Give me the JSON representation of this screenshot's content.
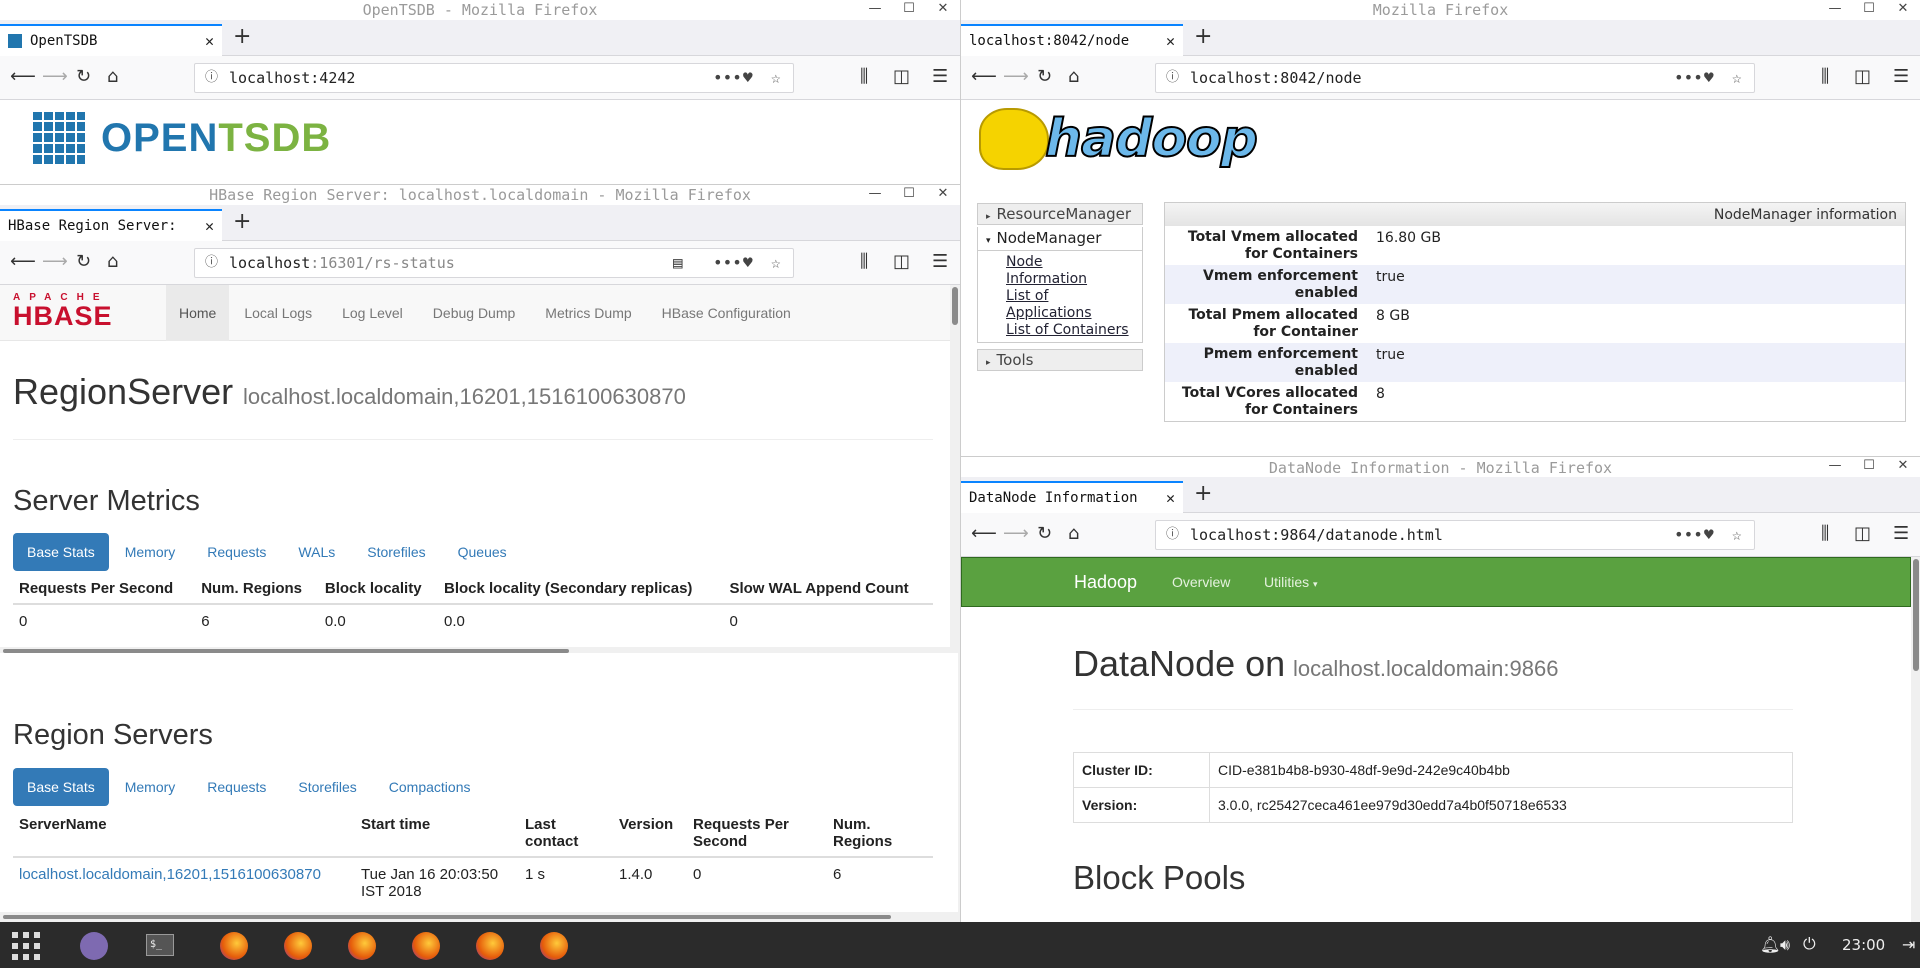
{
  "opentsdb_window": {
    "title": "OpenTSDB - Mozilla Firefox",
    "tab": "OpenTSDB",
    "url": "localhost:4242",
    "logo_open": "OPEN",
    "logo_tsdb": "TSDB"
  },
  "hbase_window": {
    "title": "HBase Region Server: localhost.localdomain - Mozilla Firefox",
    "tab": "HBase Region Server:",
    "url_host": "localhost",
    "url_rest": ":16301/rs-status",
    "nav": [
      "Home",
      "Local Logs",
      "Log Level",
      "Debug Dump",
      "Metrics Dump",
      "HBase Configuration"
    ],
    "logo_top": "APACHE",
    "logo_main": "HBASE",
    "heading": "RegionServer",
    "heading_sub": "localhost.localdomain,16201,1516100630870",
    "server_metrics": "Server Metrics",
    "metrics_tabs": [
      "Base Stats",
      "Memory",
      "Requests",
      "WALs",
      "Storefiles",
      "Queues"
    ],
    "metrics_headers": [
      "Requests Per Second",
      "Num. Regions",
      "Block locality",
      "Block locality (Secondary replicas)",
      "Slow WAL Append Count"
    ],
    "metrics_row": [
      "0",
      "6",
      "0.0",
      "0.0",
      "0"
    ],
    "region_servers": "Region Servers",
    "rs_tabs": [
      "Base Stats",
      "Memory",
      "Requests",
      "Storefiles",
      "Compactions"
    ],
    "rs_headers": [
      "ServerName",
      "Start time",
      "Last contact",
      "Version",
      "Requests Per Second",
      "Num. Regions"
    ],
    "rs_row": [
      "localhost.localdomain,16201,1516100630870",
      "Tue Jan 16 20:03:50 IST 2018",
      "1 s",
      "1.4.0",
      "0",
      "6"
    ]
  },
  "hadoop_window": {
    "title": "Mozilla Firefox",
    "tab": "localhost:8042/node",
    "url": "localhost:8042/node",
    "logo": "hadoop",
    "menu": {
      "resource_manager": "ResourceManager",
      "node_manager": "NodeManager",
      "links": [
        "Node Information",
        "List of Applications",
        "List of Containers"
      ],
      "tools": "Tools"
    },
    "info_title": "NodeManager information",
    "rows": [
      {
        "k": "Total Vmem allocated for Containers",
        "v": "16.80 GB"
      },
      {
        "k": "Vmem enforcement enabled",
        "v": "true"
      },
      {
        "k": "Total Pmem allocated for Container",
        "v": "8 GB"
      },
      {
        "k": "Pmem enforcement enabled",
        "v": "true"
      },
      {
        "k": "Total VCores allocated for Containers",
        "v": "8"
      }
    ]
  },
  "datanode_window": {
    "title": "DataNode Information - Mozilla Firefox",
    "tab": "DataNode Information",
    "url": "localhost:9864/datanode.html",
    "brand": "Hadoop",
    "nav": [
      "Overview",
      "Utilities"
    ],
    "heading": "DataNode on",
    "heading_sub": "localhost.localdomain:9866",
    "rows": [
      {
        "k": "Cluster ID:",
        "v": "CID-e381b4b8-b930-48df-9e9d-242e9c40b4bb"
      },
      {
        "k": "Version:",
        "v": "3.0.0, rc25427ceca461ee979d30edd7a4b0f50718e6533"
      }
    ],
    "block_pools": "Block Pools"
  },
  "taskbar": {
    "clock": "23:00"
  },
  "colors": {
    "hadoop_green": "#5aa140",
    "bs_blue": "#337ab7",
    "hbase_red": "#c8102e",
    "tsdb_blue": "#2176ae",
    "tsdb_green": "#7cb342"
  }
}
